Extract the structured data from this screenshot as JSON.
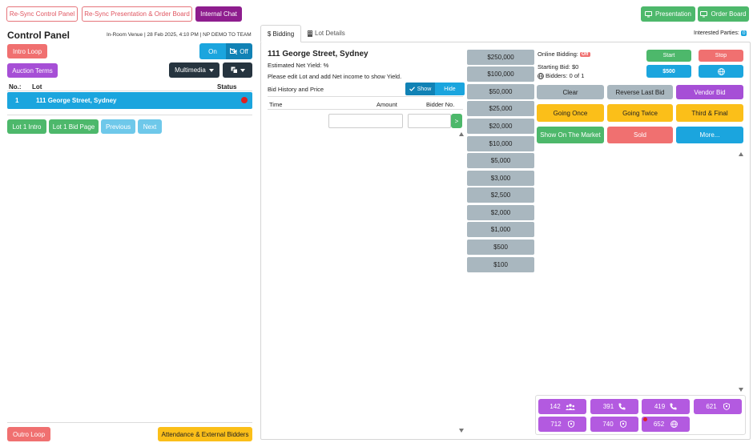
{
  "top": {
    "resync_control": "Re-Sync Control Panel",
    "resync_presentation": "Re-Sync Presentation & Order Board",
    "internal_chat": "Internal Chat",
    "presentation": "Presentation",
    "order_board": "Order Board"
  },
  "left": {
    "title": "Control Panel",
    "venue": "In-Room Venue",
    "datetime": "28 Feb 2025, 4:10 PM",
    "team": "NP DEMO TO TEAM",
    "intro_loop": "Intro Loop",
    "on": "On",
    "off": "Off",
    "auction_terms": "Auction Terms",
    "multimedia": "Multimedia",
    "col_no": "No.:",
    "col_lot": "Lot",
    "col_status": "Status",
    "lots": [
      {
        "no": "1",
        "name": "111 George Street, Sydney",
        "status_color": "#e02020"
      }
    ],
    "lot_intro": "Lot 1 Intro",
    "lot_bid_page": "Lot 1 Bid Page",
    "previous": "Previous",
    "next": "Next",
    "outro_loop": "Outro Loop",
    "attendance": "Attendance & External Bidders"
  },
  "tabs": {
    "bidding": "$ Bidding",
    "lot_details": "Lot Details",
    "interested": "Interested Parties:",
    "interested_count": "0"
  },
  "lot": {
    "address": "111 George Street, Sydney",
    "net_yield": "Estimated Net Yield: %",
    "edit_note": "Please edit Lot and add Net income to show Yield.",
    "bid_history": "Bid History and Price",
    "show": "Show",
    "hide": "Hide",
    "col_time": "Time",
    "col_amount": "Amount",
    "col_bidder": "Bidder No.",
    "amount_value": "",
    "bidder_value": "",
    "go": ">"
  },
  "increments": [
    "$250,000",
    "$100,000",
    "$50,000",
    "$25,000",
    "$20,000",
    "$10,000",
    "$5,000",
    "$3,000",
    "$2,500",
    "$2,000",
    "$1,000",
    "$500",
    "$100"
  ],
  "online": {
    "label": "Online Bidding:",
    "badge": "Off",
    "starting_bid": "Starting Bid: $0",
    "bidders": "Bidders: 0 of 1",
    "start": "Start",
    "stop": "Stop",
    "inc": "$500"
  },
  "actions": {
    "clear": "Clear",
    "reverse": "Reverse Last Bid",
    "vendor": "Vendor Bid",
    "going_once": "Going Once",
    "going_twice": "Going Twice",
    "third_final": "Third & Final",
    "on_market": "Show On The Market",
    "sold": "Sold",
    "more": "More..."
  },
  "bidders": [
    {
      "no": "142",
      "icon": "group-icon"
    },
    {
      "no": "391",
      "icon": "phone-icon"
    },
    {
      "no": "419",
      "icon": "phone-icon"
    },
    {
      "no": "621",
      "icon": "shield-icon"
    },
    {
      "no": "712",
      "icon": "shield-icon"
    },
    {
      "no": "740",
      "icon": "shield-icon"
    },
    {
      "no": "652",
      "icon": "globe-icon"
    }
  ]
}
